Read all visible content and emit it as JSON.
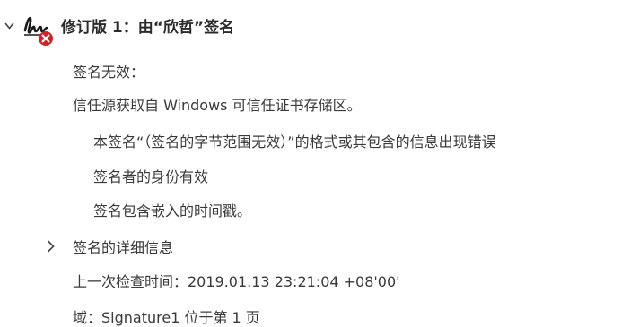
{
  "header": {
    "title": "修订版 1：由“欣哲”签名",
    "expand_icon": "chevron-down-icon",
    "status_icon": "signature-invalid-icon",
    "status_color": "#d32027"
  },
  "validity": {
    "status": "签名无效：",
    "trust_source": "信任源获取自 Windows 可信任证书存储区。",
    "details": [
      "本签名“（签名的字节范围无效）”的格式或其包含的信息出现错误",
      "签名者的身份有效",
      "签名包含嵌入的时间戳。"
    ]
  },
  "signature_details": {
    "label": "签名的详细信息",
    "expand_icon": "chevron-right-icon"
  },
  "last_checked": "上一次检查时间：2019.01.13 23:21:04 +08'00'",
  "field": "域：Signature1 位于第 1 页"
}
